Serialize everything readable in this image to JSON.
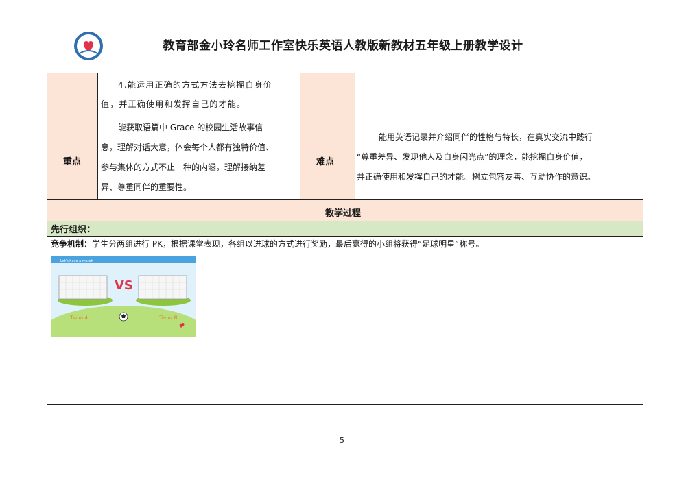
{
  "header": {
    "title": "教育部金小玲名师工作室快乐英语人教版新教材五年级上册教学设计"
  },
  "table": {
    "row1": {
      "line1": "4.能运用正确的方式方法去挖掘自身价",
      "line2": "值，并正确使用和发挥自己的才能。"
    },
    "key_points": {
      "label": "重点",
      "lines": [
        "能获取语篇中 Grace 的校园生活故事信",
        "息，理解对话大意，体会每个人都有独特价值、",
        "参与集体的方式不止一种的内涵，理解接纳差",
        "异、尊重同伴的重要性。"
      ]
    },
    "difficult_points": {
      "label": "难点",
      "lines": [
        "能用英语记录并介绍同伴的性格与特长，在真实交流中践行",
        "“尊重差异、发现他人及自身闪光点”的理念，能挖掘自身价值，",
        "并正确使用和发挥自己的才能。树立包容友善、互助协作的意识。"
      ]
    },
    "process_header": "教学过程",
    "section_title": "先行组织：",
    "competition": {
      "label": "竞争机制：",
      "text": "学生分两组进行 PK，根据课堂表现，各组以进球的方式进行奖励，最后赢得的小组将获得“足球明星”称号。"
    },
    "game_image": {
      "caption": "Let's have a match",
      "vs": "VS",
      "team_a": "Team A",
      "team_b": "Team B"
    }
  },
  "footer": {
    "page_number": "5"
  },
  "colors": {
    "pink": "#fce4d6",
    "green": "#d6e8c4",
    "grass": "#8cc63f",
    "sky": "#dff1fb"
  }
}
